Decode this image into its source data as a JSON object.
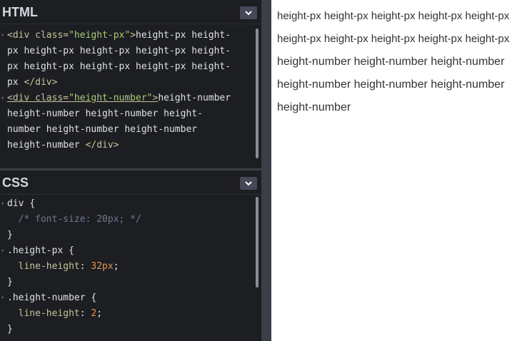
{
  "html_pane": {
    "title": "HTML",
    "lines": [
      [
        {
          "t": "<div ",
          "c": "tag"
        },
        {
          "t": "class=",
          "c": "attr"
        },
        {
          "t": "\"height-px\"",
          "c": "str"
        },
        {
          "t": ">",
          "c": "tag"
        },
        {
          "t": "height-px height-",
          "c": "sel"
        }
      ],
      [
        {
          "t": "px height-px height-px height-px height-",
          "c": "sel"
        }
      ],
      [
        {
          "t": "px height-px height-px height-px height-",
          "c": "sel"
        }
      ],
      [
        {
          "t": "px ",
          "c": "sel"
        },
        {
          "t": "</div>",
          "c": "tag"
        }
      ],
      [
        {
          "t": "<div class=",
          "c": "tag underline"
        },
        {
          "t": "\"height-number\"",
          "c": "str underline"
        },
        {
          "t": ">",
          "c": "tag underline"
        },
        {
          "t": "height-number",
          "c": "sel"
        }
      ],
      [
        {
          "t": "height-number height-number height-",
          "c": "sel"
        }
      ],
      [
        {
          "t": "number height-number height-number",
          "c": "sel"
        }
      ],
      [
        {
          "t": "height-number ",
          "c": "sel"
        },
        {
          "t": "</div>",
          "c": "tag"
        }
      ]
    ],
    "fold_markers": [
      0,
      4
    ]
  },
  "css_pane": {
    "title": "CSS",
    "lines": [
      [
        {
          "t": "div ",
          "c": "sel"
        },
        {
          "t": "{",
          "c": "sel"
        }
      ],
      [
        {
          "t": "  /* font-size: 20px; */",
          "c": "comment"
        }
      ],
      [
        {
          "t": "}",
          "c": "sel"
        }
      ],
      [
        {
          "t": ".height-px ",
          "c": "sel"
        },
        {
          "t": "{",
          "c": "sel"
        }
      ],
      [
        {
          "t": "  line-height",
          "c": "prop"
        },
        {
          "t": ": ",
          "c": "sel"
        },
        {
          "t": "32px",
          "c": "num"
        },
        {
          "t": ";",
          "c": "sel"
        }
      ],
      [
        {
          "t": "}",
          "c": "sel"
        }
      ],
      [
        {
          "t": ".height-number ",
          "c": "sel"
        },
        {
          "t": "{",
          "c": "sel"
        }
      ],
      [
        {
          "t": "  line-height",
          "c": "prop"
        },
        {
          "t": ": ",
          "c": "sel"
        },
        {
          "t": "2",
          "c": "num"
        },
        {
          "t": ";",
          "c": "sel"
        }
      ],
      [
        {
          "t": "}",
          "c": "sel"
        }
      ]
    ],
    "fold_markers": [
      0,
      3,
      6
    ]
  },
  "icons": {
    "pane_menu": "chevron-down-icon"
  },
  "preview": {
    "height_px_text": "height-px height-px height-px height-px height-px height-px height-px height-px height-px height-px",
    "height_number_text": "height-number height-number height-number height-number height-number height-number height-number"
  },
  "colors": {
    "editor_bg": "#1d1e22",
    "divider": "#3c3e47",
    "tag": "#c6c39a",
    "string": "#a8c97b",
    "number": "#e4954a",
    "comment": "#717790"
  }
}
